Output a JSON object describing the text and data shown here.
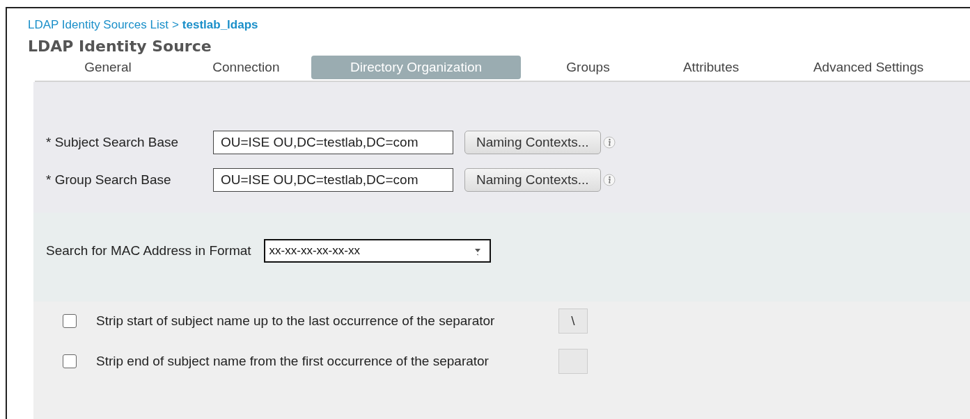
{
  "breadcrumb": {
    "link": "LDAP Identity Sources List",
    "separator": ">",
    "current": "testlab_ldaps"
  },
  "title": "LDAP Identity Source",
  "tabs": [
    {
      "label": "General",
      "selected": false
    },
    {
      "label": "Connection",
      "selected": false
    },
    {
      "label": "Directory Organization",
      "selected": true
    },
    {
      "label": "Groups",
      "selected": false
    },
    {
      "label": "Attributes",
      "selected": false
    },
    {
      "label": "Advanced Settings",
      "selected": false
    }
  ],
  "search_bases": [
    {
      "label": "* Subject Search Base",
      "value": "OU=ISE OU,DC=testlab,DC=com",
      "button": "Naming Contexts..."
    },
    {
      "label": "* Group Search Base",
      "value": "OU=ISE OU,DC=testlab,DC=com",
      "button": "Naming Contexts..."
    }
  ],
  "mac_format": {
    "label": "Search for MAC Address in Format",
    "value": "xx-xx-xx-xx-xx-xx"
  },
  "strip_options": [
    {
      "label": "Strip start of subject name up to the last occurrence of the separator",
      "checked": false,
      "separator": "\\"
    },
    {
      "label": "Strip end of subject name from the first occurrence of the separator",
      "checked": false
    }
  ]
}
